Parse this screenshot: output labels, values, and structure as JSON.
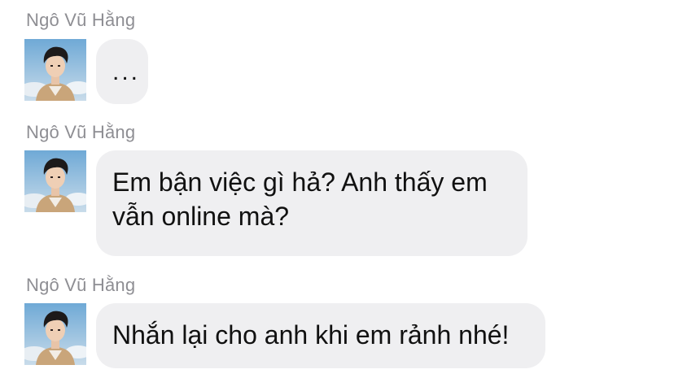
{
  "messages": [
    {
      "sender": "Ngô Vũ Hằng",
      "text": "..."
    },
    {
      "sender": "Ngô Vũ Hằng",
      "text": "Em bận việc gì hả? Anh thấy em\nvẫn online mà?"
    },
    {
      "sender": "Ngô Vũ Hằng",
      "text": "Nhắn lại cho anh khi em rảnh nhé!"
    }
  ],
  "colors": {
    "bubble": "#efeff1",
    "sender_name": "#8e8e93",
    "text": "#111111"
  },
  "icons": {
    "avatar": "profile-photo"
  }
}
